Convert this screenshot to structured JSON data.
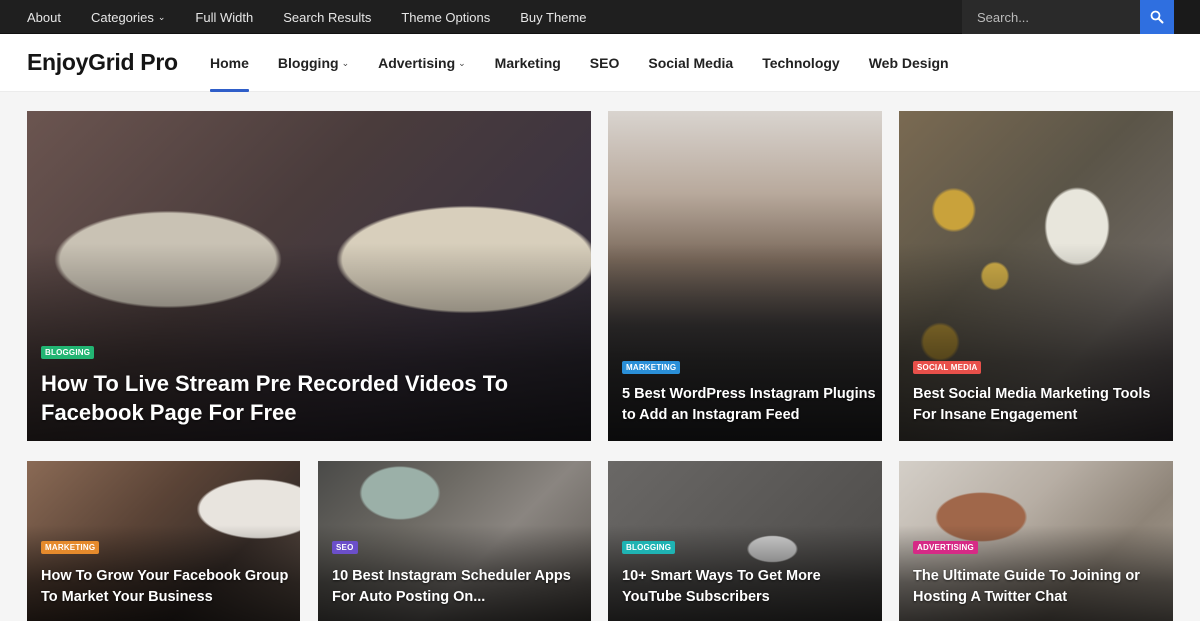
{
  "topbar": {
    "nav": [
      {
        "label": "About",
        "has_dropdown": false
      },
      {
        "label": "Categories",
        "has_dropdown": true
      },
      {
        "label": "Full Width",
        "has_dropdown": false
      },
      {
        "label": "Search Results",
        "has_dropdown": false
      },
      {
        "label": "Theme Options",
        "has_dropdown": false
      },
      {
        "label": "Buy Theme",
        "has_dropdown": false
      }
    ],
    "search": {
      "placeholder": "Search...",
      "value": "",
      "icon": "search-icon"
    }
  },
  "header": {
    "logo": "EnjoyGrid Pro",
    "nav": [
      {
        "label": "Home",
        "active": true,
        "has_dropdown": false
      },
      {
        "label": "Blogging",
        "active": false,
        "has_dropdown": true
      },
      {
        "label": "Advertising",
        "active": false,
        "has_dropdown": true
      },
      {
        "label": "Marketing",
        "active": false,
        "has_dropdown": false
      },
      {
        "label": "SEO",
        "active": false,
        "has_dropdown": false
      },
      {
        "label": "Social Media",
        "active": false,
        "has_dropdown": false
      },
      {
        "label": "Technology",
        "active": false,
        "has_dropdown": false
      },
      {
        "label": "Web Design",
        "active": false,
        "has_dropdown": false
      }
    ],
    "accent_color": "#2f5ec9"
  },
  "posts": [
    {
      "category": "Blogging",
      "category_color": "#22b573",
      "title": "How To Live Stream Pre Recorded Videos To Facebook Page For Free"
    },
    {
      "category": "Marketing",
      "category_color": "#2a8fd8",
      "title": "5 Best WordPress Instagram Plugins to Add an Instagram Feed"
    },
    {
      "category": "Social Media",
      "category_color": "#e8504a",
      "title": "Best Social Media Marketing Tools For Insane Engagement"
    },
    {
      "category": "Marketing",
      "category_color": "#e58a2c",
      "title": "How To Grow Your Facebook Group To Market Your Business"
    },
    {
      "category": "SEO",
      "category_color": "#6b4fc9",
      "title": "10 Best Instagram Scheduler Apps For Auto Posting On..."
    },
    {
      "category": "Blogging",
      "category_color": "#1fb3b3",
      "title": "10+ Smart Ways To Get More YouTube Subscribers"
    },
    {
      "category": "Advertising",
      "category_color": "#d62a86",
      "title": "The Ultimate Guide To Joining or Hosting A Twitter Chat"
    }
  ]
}
